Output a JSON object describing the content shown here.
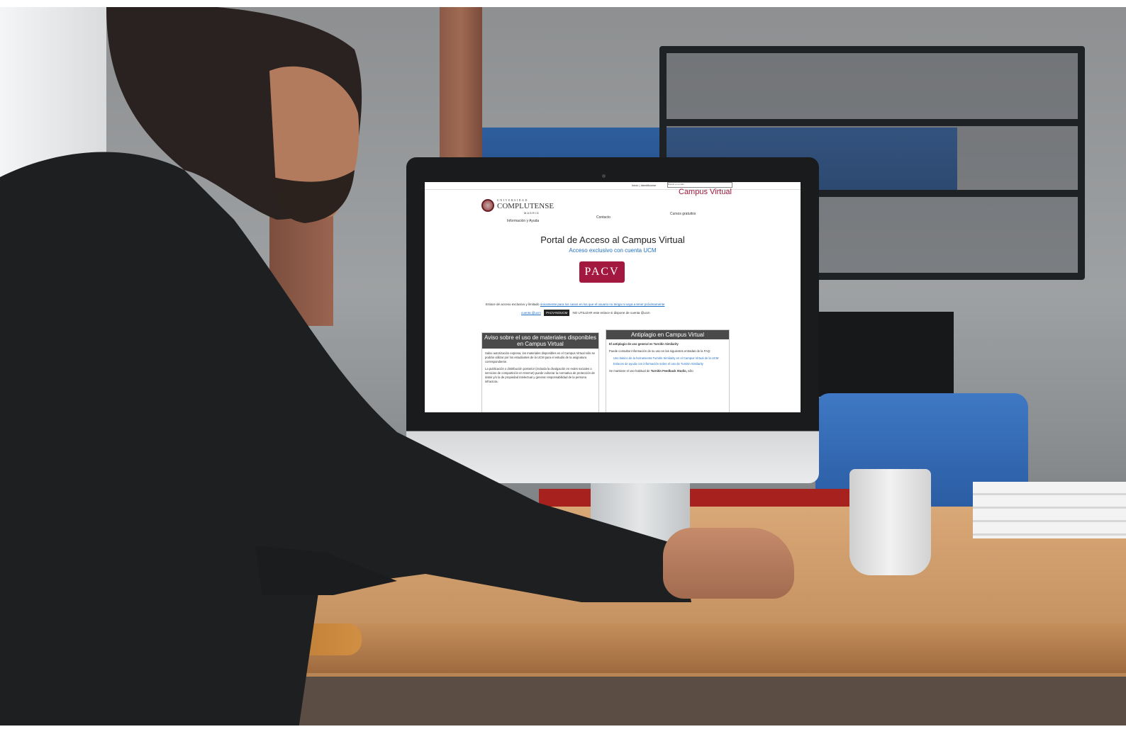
{
  "screen": {
    "topbar": {
      "identify_link": "Inicio | Identificarse",
      "search_placeholder": "Buscar en el sitio"
    },
    "site_name": "Campus Virtual",
    "logo": {
      "line1": "UNIVERSIDAD",
      "line2": "COMPLUTENSE",
      "line3": "MADRID"
    },
    "nav": {
      "info": "Información y Ayuda",
      "contact": "Contacto",
      "courses": "Cursos gratuitos"
    },
    "page_title": "Portal de Acceso al Campus Virtual",
    "subtitle": "Acceso exclusivo con cuenta UCM",
    "pacv_button": "PACV",
    "notice": {
      "prefix": "Enlace de acceso exclusivo y limitado",
      "link": "únicamente para los casos en los que el usuario no tenga ni vaya a tener próximamente",
      "link2": "cuenta @ucm",
      "badge": "PACV-NOUCM",
      "suffix": "NO UTILIZAR este enlace si dispone de cuenta @ucm"
    },
    "box_left": {
      "header": "Aviso sobre el uso de materiales disponibles en Campus Virtual",
      "p1": "Salvo autorización expresa, los materiales disponibles en el Campus Virtual sólo se podrán utilizar por los estudiantes de la UCM para el estudio de la asignatura correspondiente.",
      "p2": "La publicación o distribución posterior (incluida la divulgación en redes sociales o servicios de compartición en Internet) puede vulnerar la normativa de protección de datos y/o la de propiedad intelectual y generar responsabilidad de la persona infractora."
    },
    "box_right": {
      "header": "Antiplagio en Campus Virtual",
      "p1": "El antiplagio de uso general es Turnitin Similarity",
      "p2": "Puede consultar información de su uso en las siguientes entradas de la FAQ:",
      "link1": "Uso básico de la herramienta Turnitin Similarity en el Campus Virtual de la UCM",
      "link2": "Enlaces de ayuda con información sobre el uso de Turnitin Similarity",
      "p3_prefix": "Se mantiene el uso habitual de",
      "p3_bold": "Turnitin Feedback Studio,",
      "p3_suffix": "sólo"
    }
  }
}
